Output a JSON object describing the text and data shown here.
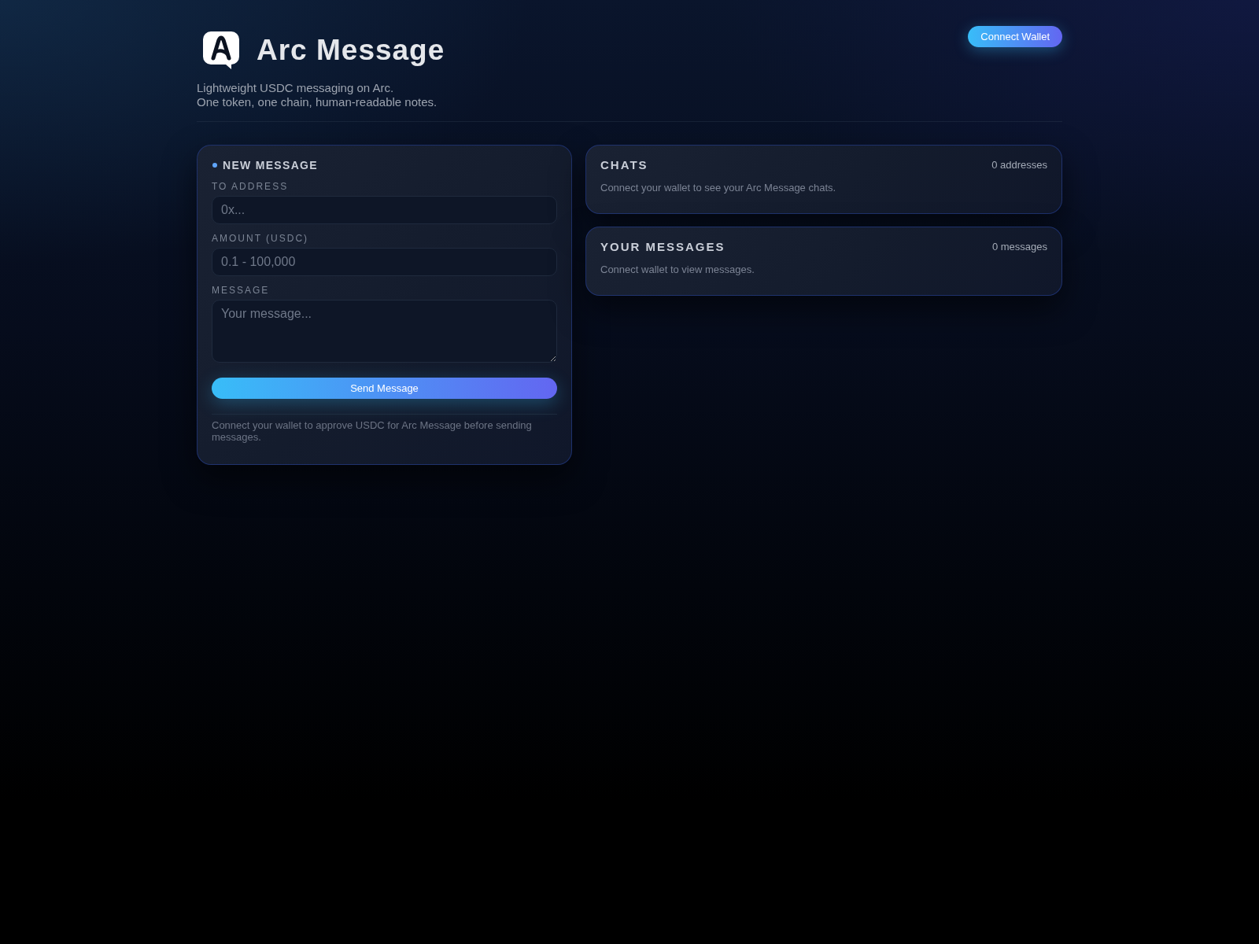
{
  "header": {
    "title": "Arc Message",
    "tagline_lines": [
      "Lightweight USDC messaging on Arc.",
      "One token, one chain, human-readable notes."
    ],
    "connect_button": "Connect Wallet"
  },
  "new_message": {
    "title": "NEW MESSAGE",
    "fields": [
      {
        "kind": "input",
        "label": "TO ADDRESS",
        "placeholder": "0x..."
      },
      {
        "kind": "input",
        "label": "AMOUNT (USDC)",
        "placeholder": "0.1 - 100,000"
      },
      {
        "kind": "textarea",
        "label": "MESSAGE",
        "placeholder": "Your message..."
      }
    ],
    "send_button": "Send Message",
    "note": "Connect your wallet to approve USDC for Arc Message before sending messages."
  },
  "panels": [
    {
      "title": "CHATS",
      "count": "0 addresses",
      "text": "Connect your wallet to see your Arc Message chats."
    },
    {
      "title": "YOUR MESSAGES",
      "count": "0 messages",
      "text": "Connect wallet to view messages."
    }
  ]
}
